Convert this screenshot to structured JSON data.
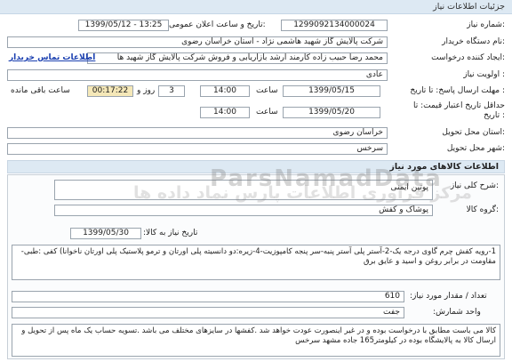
{
  "header": {
    "title": "جزئیات اطلاعات نیاز"
  },
  "fields": {
    "need_number_label": "شماره نیاز:",
    "need_number": "1299092134000024",
    "announce_label": "تاریخ و ساعت اعلان عمومی:",
    "announce": "1399/05/12 - 13:25",
    "buyer_label": "نام دستگاه خریدار:",
    "buyer": "شرکت پالایش گاز شهید هاشمی نژاد - استان خراسان رضوی",
    "creator_label": "ایجاد کننده درخواست:",
    "creator": "محمد رضا حبیب زاده کارمند ارشد بازاریابی و فروش شرکت پالایش گاز شهید ها",
    "contact_link": "اطلاعات تماس خریدار",
    "priority_label": "اولویت نیاز :",
    "priority": "عادی",
    "deadline_label": "مهلت ارسال پاسخ:  تا تاریخ :",
    "deadline_date": "1399/05/15",
    "time_label": "ساعت",
    "deadline_time": "14:00",
    "days": "3",
    "day_label": "روز و",
    "remaining": "00:17:22",
    "remaining_label": "ساعت باقی مانده",
    "validity_label": "حداقل تاریخ اعتبار قیمت:  تا تاریخ :",
    "validity_date": "1399/05/20",
    "validity_time": "14:00",
    "province_label": "استان محل تحویل:",
    "province": "خراسان رضوی",
    "city_label": "شهر محل تحویل:",
    "city": "سرخس"
  },
  "goods": {
    "section_title": "اطلاعات کالاهای مورد نیاز",
    "summary_label": "شرح کلی نیاز:",
    "summary": "پوتین ایمنی",
    "group_label": "گروه کالا:",
    "group": "پوشاک و کفش",
    "need_date_label": "تاریخ نیاز به کالا:",
    "need_date": "1399/05/30",
    "description": "1-رویه کفش چرم گاوی درجه یک-2-آستر پلی آستر پنبه-سر پنجه کامپوزیت-4-زیره:دو دانسیته پلی اورتان و ترمو پلاستیک پلی اورتان ناخوانا) کفی :طبی-مقاومت در برابر روغن و اسید و عایق برق",
    "qty_label": "تعداد / مقدار مورد نیاز:",
    "qty": "610",
    "unit_label": "واحد شمارش:",
    "unit": "جفت",
    "notes": "کالا می باست مطابق با درخواست بوده و در غیر اینصورت عودت خواهد شد .کفشها در سایزهای مختلف می باشد .تسویه حساب یک ماه پس از تحویل و ارسال کالا به پالایشگاه بوده در کیلومتر165 جاده مشهد سرخس"
  },
  "watermark": {
    "latin": "ParsNamadData",
    "persian": "مرکز فراوری اطلاعات پارس نماد داده ها"
  }
}
